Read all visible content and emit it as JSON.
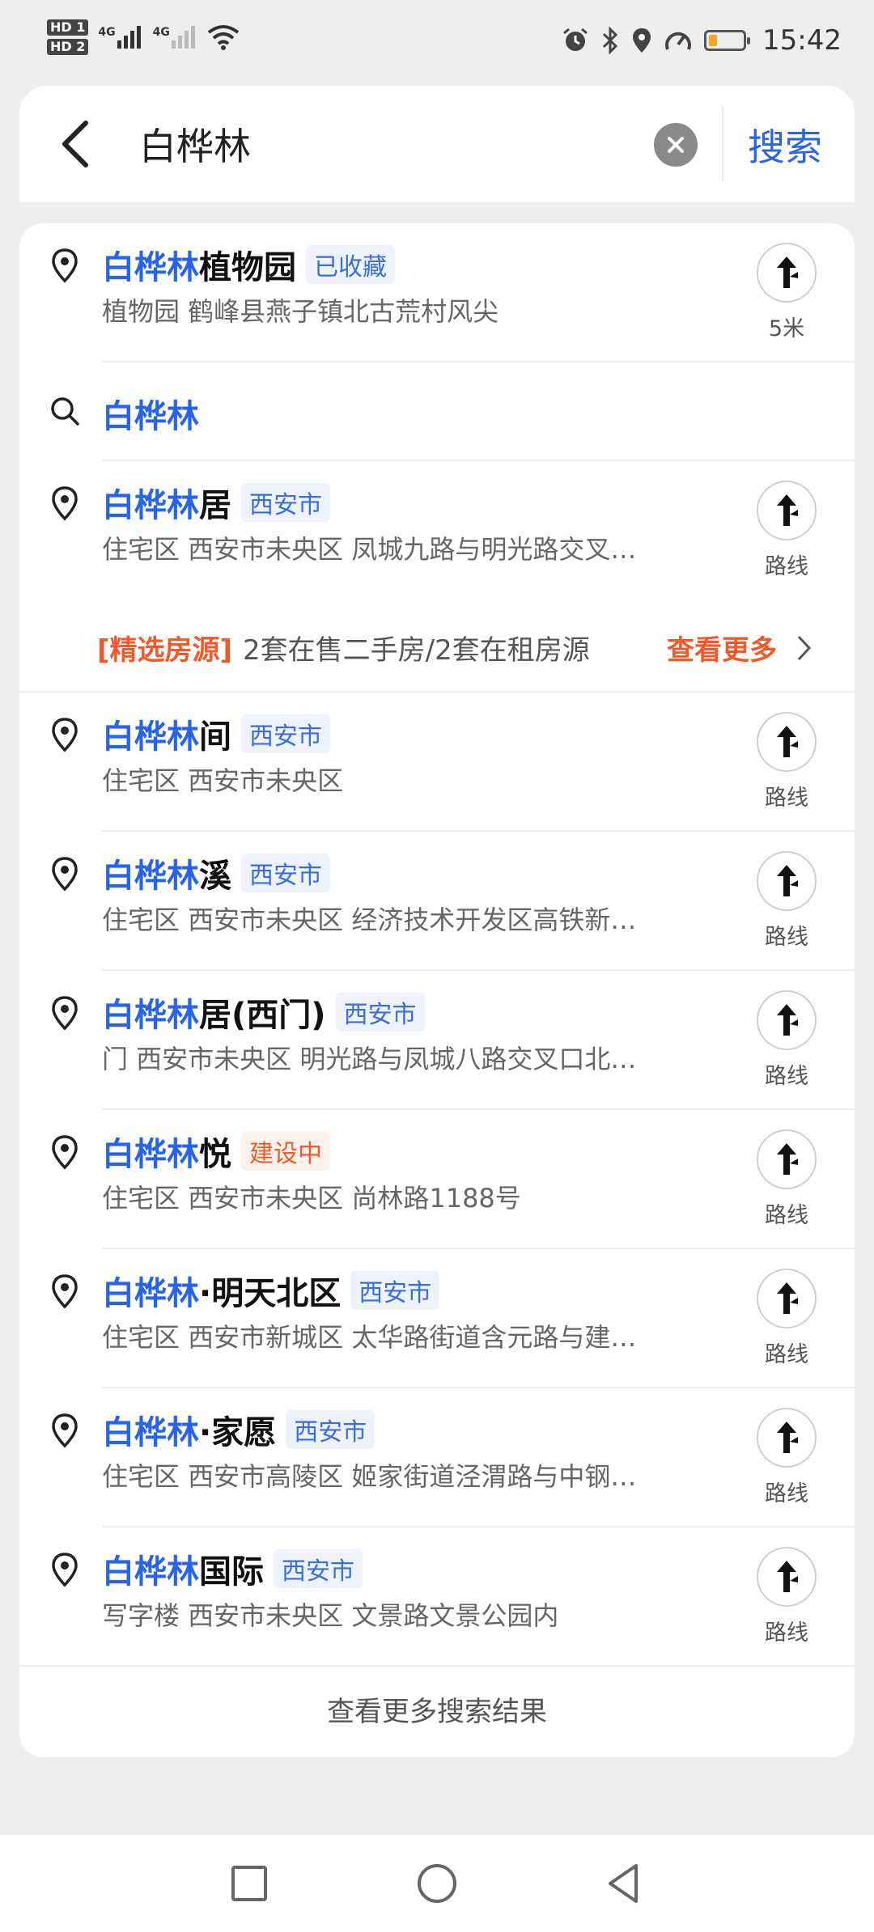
{
  "status_bar": {
    "sim1": "HD 1",
    "sim2": "HD 2",
    "net1": "4G",
    "net2": "4G",
    "time": "15:42",
    "battery_level": 0.25,
    "icons": [
      "alarm-icon",
      "bluetooth-icon",
      "location-icon",
      "speed-icon",
      "battery-icon"
    ]
  },
  "search": {
    "query": "白桦林",
    "clear_icon": "close-icon",
    "submit_label": "搜索"
  },
  "results": [
    {
      "hl": "白桦林",
      "rest": "植物园",
      "tag": "已收藏",
      "tag_type": "normal",
      "sub": "植物园  鹤峰县燕子镇北古荒村风尖",
      "route": "5米"
    },
    {
      "hl": "白桦林",
      "rest": "居",
      "tag": "西安市",
      "tag_type": "normal",
      "sub": "住宅区  西安市未央区 凤城九路与明光路交叉…",
      "route": "路线"
    },
    {
      "hl": "白桦林",
      "rest": "间",
      "tag": "西安市",
      "tag_type": "normal",
      "sub": "住宅区  西安市未央区",
      "route": "路线"
    },
    {
      "hl": "白桦林",
      "rest": "溪",
      "tag": "西安市",
      "tag_type": "normal",
      "sub": "住宅区  西安市未央区 经济技术开发区高铁新…",
      "route": "路线"
    },
    {
      "hl": "白桦林",
      "rest": "居(西门)",
      "tag": "西安市",
      "tag_type": "normal",
      "sub": "门  西安市未央区 明光路与凤城八路交叉口北…",
      "route": "路线"
    },
    {
      "hl": "白桦林",
      "rest": "悦",
      "tag": "建设中",
      "tag_type": "warn",
      "sub": "住宅区  西安市未央区 尚林路1188号",
      "route": "路线"
    },
    {
      "hl": "白桦林",
      "rest": "·明天北区",
      "tag": "西安市",
      "tag_type": "normal",
      "sub": "住宅区  西安市新城区 太华路街道含元路与建…",
      "route": "路线"
    },
    {
      "hl": "白桦林",
      "rest": "·家愿",
      "tag": "西安市",
      "tag_type": "normal",
      "sub": "住宅区  西安市高陵区 姬家街道泾渭路与中钢…",
      "route": "路线"
    },
    {
      "hl": "白桦林",
      "rest": "国际",
      "tag": "西安市",
      "tag_type": "normal",
      "sub": "写字楼  西安市未央区 文景路文景公园内",
      "route": "路线"
    }
  ],
  "query_suggestion": "白桦林",
  "promo": {
    "prefix": "[精选房源]",
    "text": "2套在售二手房/2套在租房源",
    "more": "查看更多"
  },
  "more_results": "查看更多搜索结果",
  "colors": {
    "accent": "#2a64e6",
    "warn": "#f05a2b",
    "background": "#eeeeee"
  }
}
